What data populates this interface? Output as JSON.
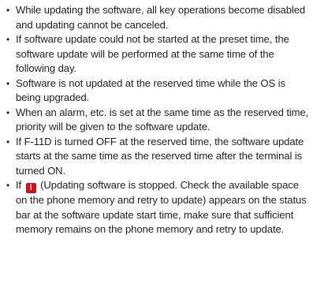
{
  "notes": [
    "While updating the software, all key operations become disabled and updating cannot be canceled.",
    "If software update could not be started at the preset time, the software update will be performed at the same time of the following day.",
    "Software is not updated at the reserved time while the OS is being upgraded.",
    "When an alarm, etc. is set at the same time as the reserved time, priority will be given to the software update.",
    "If F-11D is turned OFF at the reserved time, the software update starts at the same time as the reserved time after the terminal is turned ON."
  ],
  "last_note": {
    "prefix": "If",
    "icon_glyph": "!",
    "icon_name": "update-stopped-icon",
    "icon_color": "#d0121b",
    "text": "(Updating software is stopped. Check the available space on the phone memory and retry to update) appears on the status bar at the software update start time, make sure that sufficient memory remains on the phone memory and retry to update."
  },
  "bullet": "•"
}
